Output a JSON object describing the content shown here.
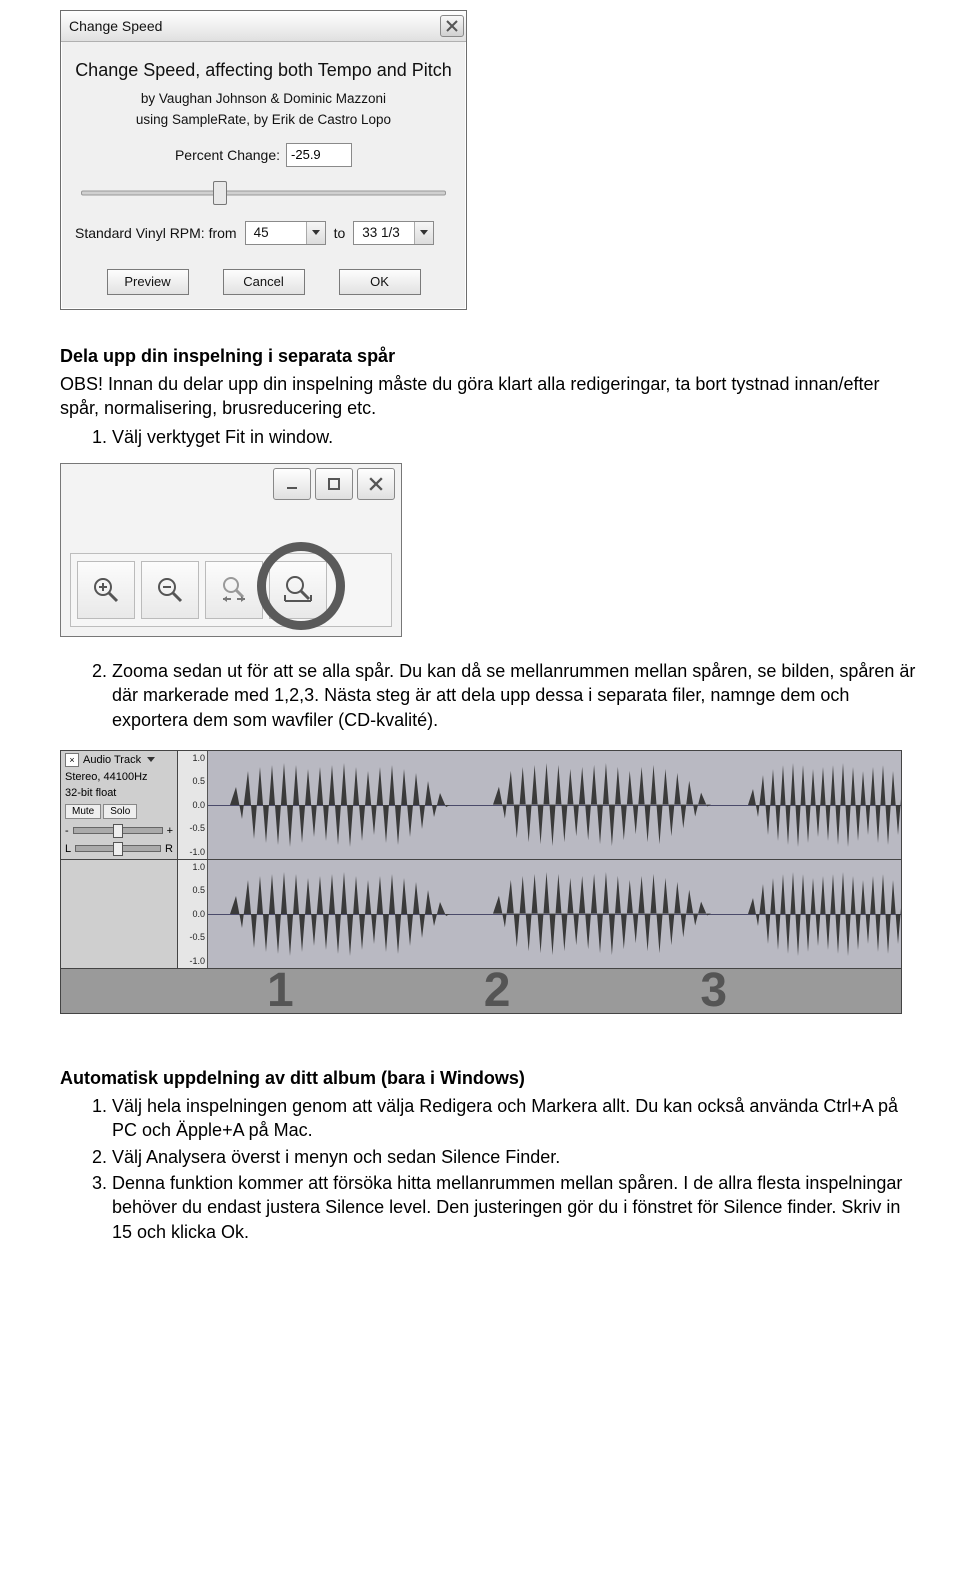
{
  "dialog": {
    "title": "Change Speed",
    "desc": "Change Speed, affecting both Tempo and Pitch",
    "credit1": "by Vaughan Johnson & Dominic Mazzoni",
    "credit2": "using SampleRate, by Erik de Castro Lopo",
    "percent_label": "Percent Change:",
    "percent_value": "-25.9",
    "rpm_label": "Standard Vinyl RPM:   from",
    "rpm_from": "45",
    "rpm_to_label": "to",
    "rpm_to": "33 1/3",
    "btn_preview": "Preview",
    "btn_cancel": "Cancel",
    "btn_ok": "OK"
  },
  "sec1": {
    "heading": "Dela upp din inspelning i separata spår",
    "p1": "OBS! Innan du delar upp din inspelning måste du göra klart alla redigeringar, ta bort tystnad innan/efter spår, normalisering, brusreducering etc.",
    "li1": "Välj verktyget Fit in window."
  },
  "sec2": {
    "li2": "Zooma sedan ut för att se alla spår. Du kan då se mellanrummen mellan spåren, se bilden, spåren är där markerade med 1,2,3. Nästa steg är att dela upp dessa i separata filer, namnge dem och exportera dem som wavfiler (CD-kvalité)."
  },
  "track": {
    "name": "Audio Track",
    "fmt1": "Stereo, 44100Hz",
    "fmt2": "32-bit float",
    "mute": "Mute",
    "solo": "Solo",
    "L": "L",
    "R": "R",
    "plus": "+",
    "minus": "-",
    "s1": "1.0",
    "s2": "0.5",
    "s3": "0.0",
    "s4": "-0.5",
    "s5": "-1.0",
    "n1": "1",
    "n2": "2",
    "n3": "3"
  },
  "sec3": {
    "heading": "Automatisk uppdelning av ditt album (bara i Windows)",
    "li1": "Välj hela inspelningen genom att välja Redigera och Markera allt. Du kan också använda Ctrl+A på PC och Äpple+A på Mac.",
    "li2": "Välj Analysera överst i menyn och sedan Silence Finder.",
    "li3": "Denna funktion kommer att försöka hitta mellanrummen mellan spåren. I de allra flesta inspelningar behöver du endast justera Silence level. Den justeringen gör du i fönstret för Silence finder. Skriv in 15 och klicka Ok."
  }
}
